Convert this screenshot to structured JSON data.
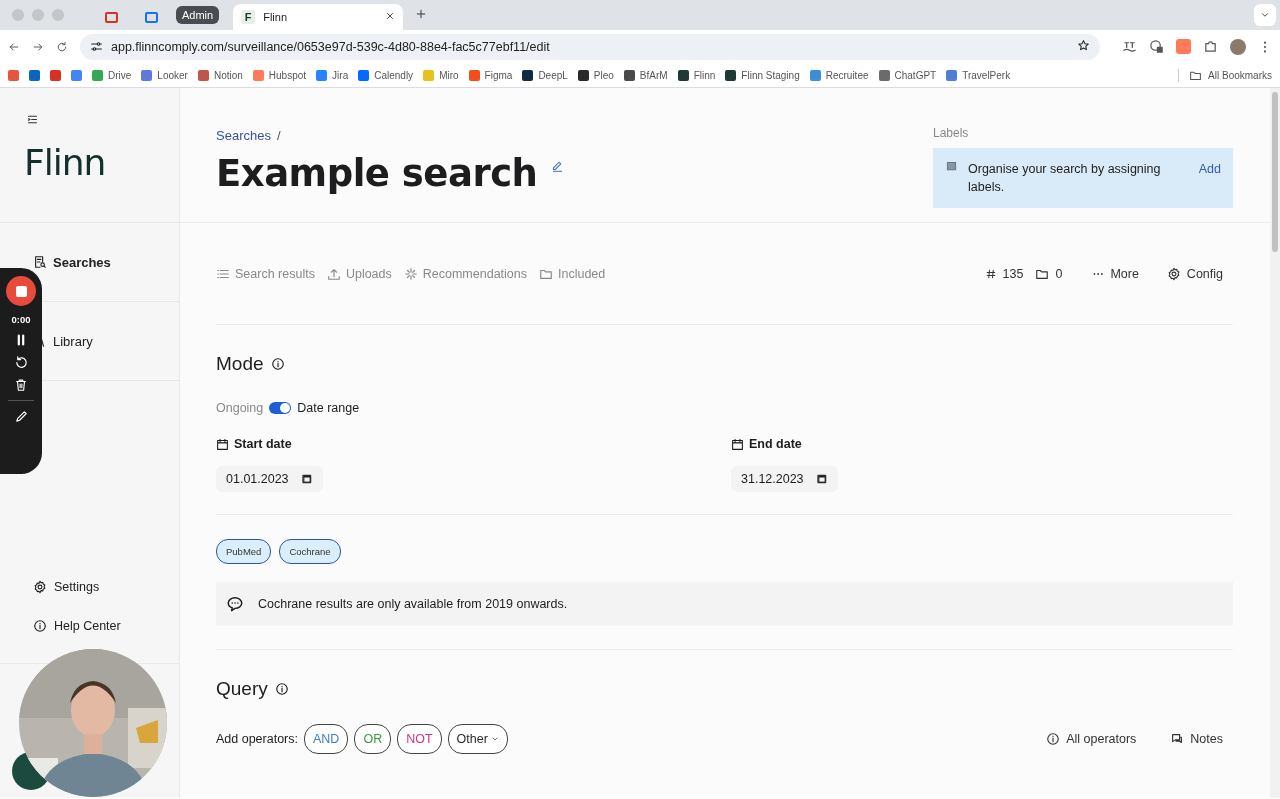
{
  "browser": {
    "pinned_tabs": [
      {
        "color": "#d93025"
      },
      {
        "color": "#1a73e8"
      }
    ],
    "tab_group": "Admin",
    "tabs": [
      {
        "favicon": "F",
        "title": "Flinn",
        "selected": true
      }
    ],
    "address": "app.flinncomply.com/surveillance/0653e97d-539c-4d80-88e4-fac5c77ebf11/edit",
    "bookmarks": [
      {
        "color": "#e8553f"
      },
      {
        "color": "#0a66c2"
      },
      {
        "color": "#d93025"
      },
      {
        "color": "#4285f4"
      },
      {
        "label": "Drive",
        "color": "#34a853"
      },
      {
        "label": "Looker",
        "color": "#5f7ad8"
      },
      {
        "label": "Notion",
        "color": "#c0564a"
      },
      {
        "label": "Hubspot",
        "color": "#ff7a59"
      },
      {
        "label": "Jira",
        "color": "#2684ff"
      },
      {
        "label": "Calendly",
        "color": "#006bff"
      },
      {
        "label": "Miro",
        "color": "#e8c21c"
      },
      {
        "label": "Figma",
        "color": "#f24e1e"
      },
      {
        "label": "DeepL",
        "color": "#0f2b46"
      },
      {
        "label": "Pleo",
        "color": "#2a2a2a"
      },
      {
        "label": "BfArM",
        "color": "#4a4a4a"
      },
      {
        "label": "Flinn",
        "color": "#1f3a34"
      },
      {
        "label": "Flinn Staging",
        "color": "#1f3a34"
      },
      {
        "label": "Recruitee",
        "color": "#3b8fd9"
      },
      {
        "label": "ChatGPT",
        "color": "#6b6b6b"
      },
      {
        "label": "TravelPerk",
        "color": "#4d7fd6"
      }
    ],
    "all_bookmarks": "All Bookmarks"
  },
  "sidebar": {
    "logo": "Flinn",
    "nav": [
      {
        "label": "Searches",
        "kind": "searches",
        "selected": true
      },
      {
        "label": "Library",
        "kind": "library",
        "selected": false
      }
    ],
    "footer": [
      {
        "label": "Settings",
        "kind": "settings"
      },
      {
        "label": "Help Center",
        "kind": "help"
      }
    ]
  },
  "recorder": {
    "time": "0:00"
  },
  "header": {
    "breadcrumb": "Searches",
    "separator": "/",
    "title": "Example search",
    "labels": {
      "heading": "Labels",
      "message": "Organise your search by assigning labels.",
      "action": "Add"
    }
  },
  "tabs": [
    {
      "label": "Search results",
      "kind": "list"
    },
    {
      "label": "Uploads",
      "kind": "upload"
    },
    {
      "label": "Recommendations",
      "kind": "sparkle"
    },
    {
      "label": "Included",
      "kind": "folder"
    }
  ],
  "stats": [
    {
      "kind": "count",
      "value": "135"
    },
    {
      "kind": "folder",
      "value": "0"
    }
  ],
  "actions": [
    {
      "kind": "more",
      "label": "More"
    },
    {
      "kind": "config",
      "label": "Config"
    }
  ],
  "mode": {
    "heading": "Mode",
    "toggle": {
      "off_label": "Ongoing",
      "on_label": "Date range",
      "on": true
    },
    "dates": [
      {
        "label": "Start date",
        "value": "01.01.2023"
      },
      {
        "label": "End date",
        "value": "31.12.2023"
      }
    ],
    "sources": [
      {
        "label": "PubMed",
        "selected": true
      },
      {
        "label": "Cochrane",
        "selected": true
      }
    ],
    "notice": "Cochrane results are only available from 2019 onwards."
  },
  "query": {
    "heading": "Query",
    "operators_label": "Add operators:",
    "operators": [
      {
        "label": "AND",
        "color": "#3b82c4",
        "kind": "button"
      },
      {
        "label": "OR",
        "color": "#3a9a3a",
        "kind": "button"
      },
      {
        "label": "NOT",
        "color": "#d0347f",
        "kind": "button"
      },
      {
        "label": "Other",
        "color": "#2a2a2a",
        "kind": "dropdown"
      }
    ],
    "links": [
      {
        "kind": "info",
        "label": "All operators"
      },
      {
        "kind": "notes",
        "label": "Notes"
      }
    ]
  }
}
